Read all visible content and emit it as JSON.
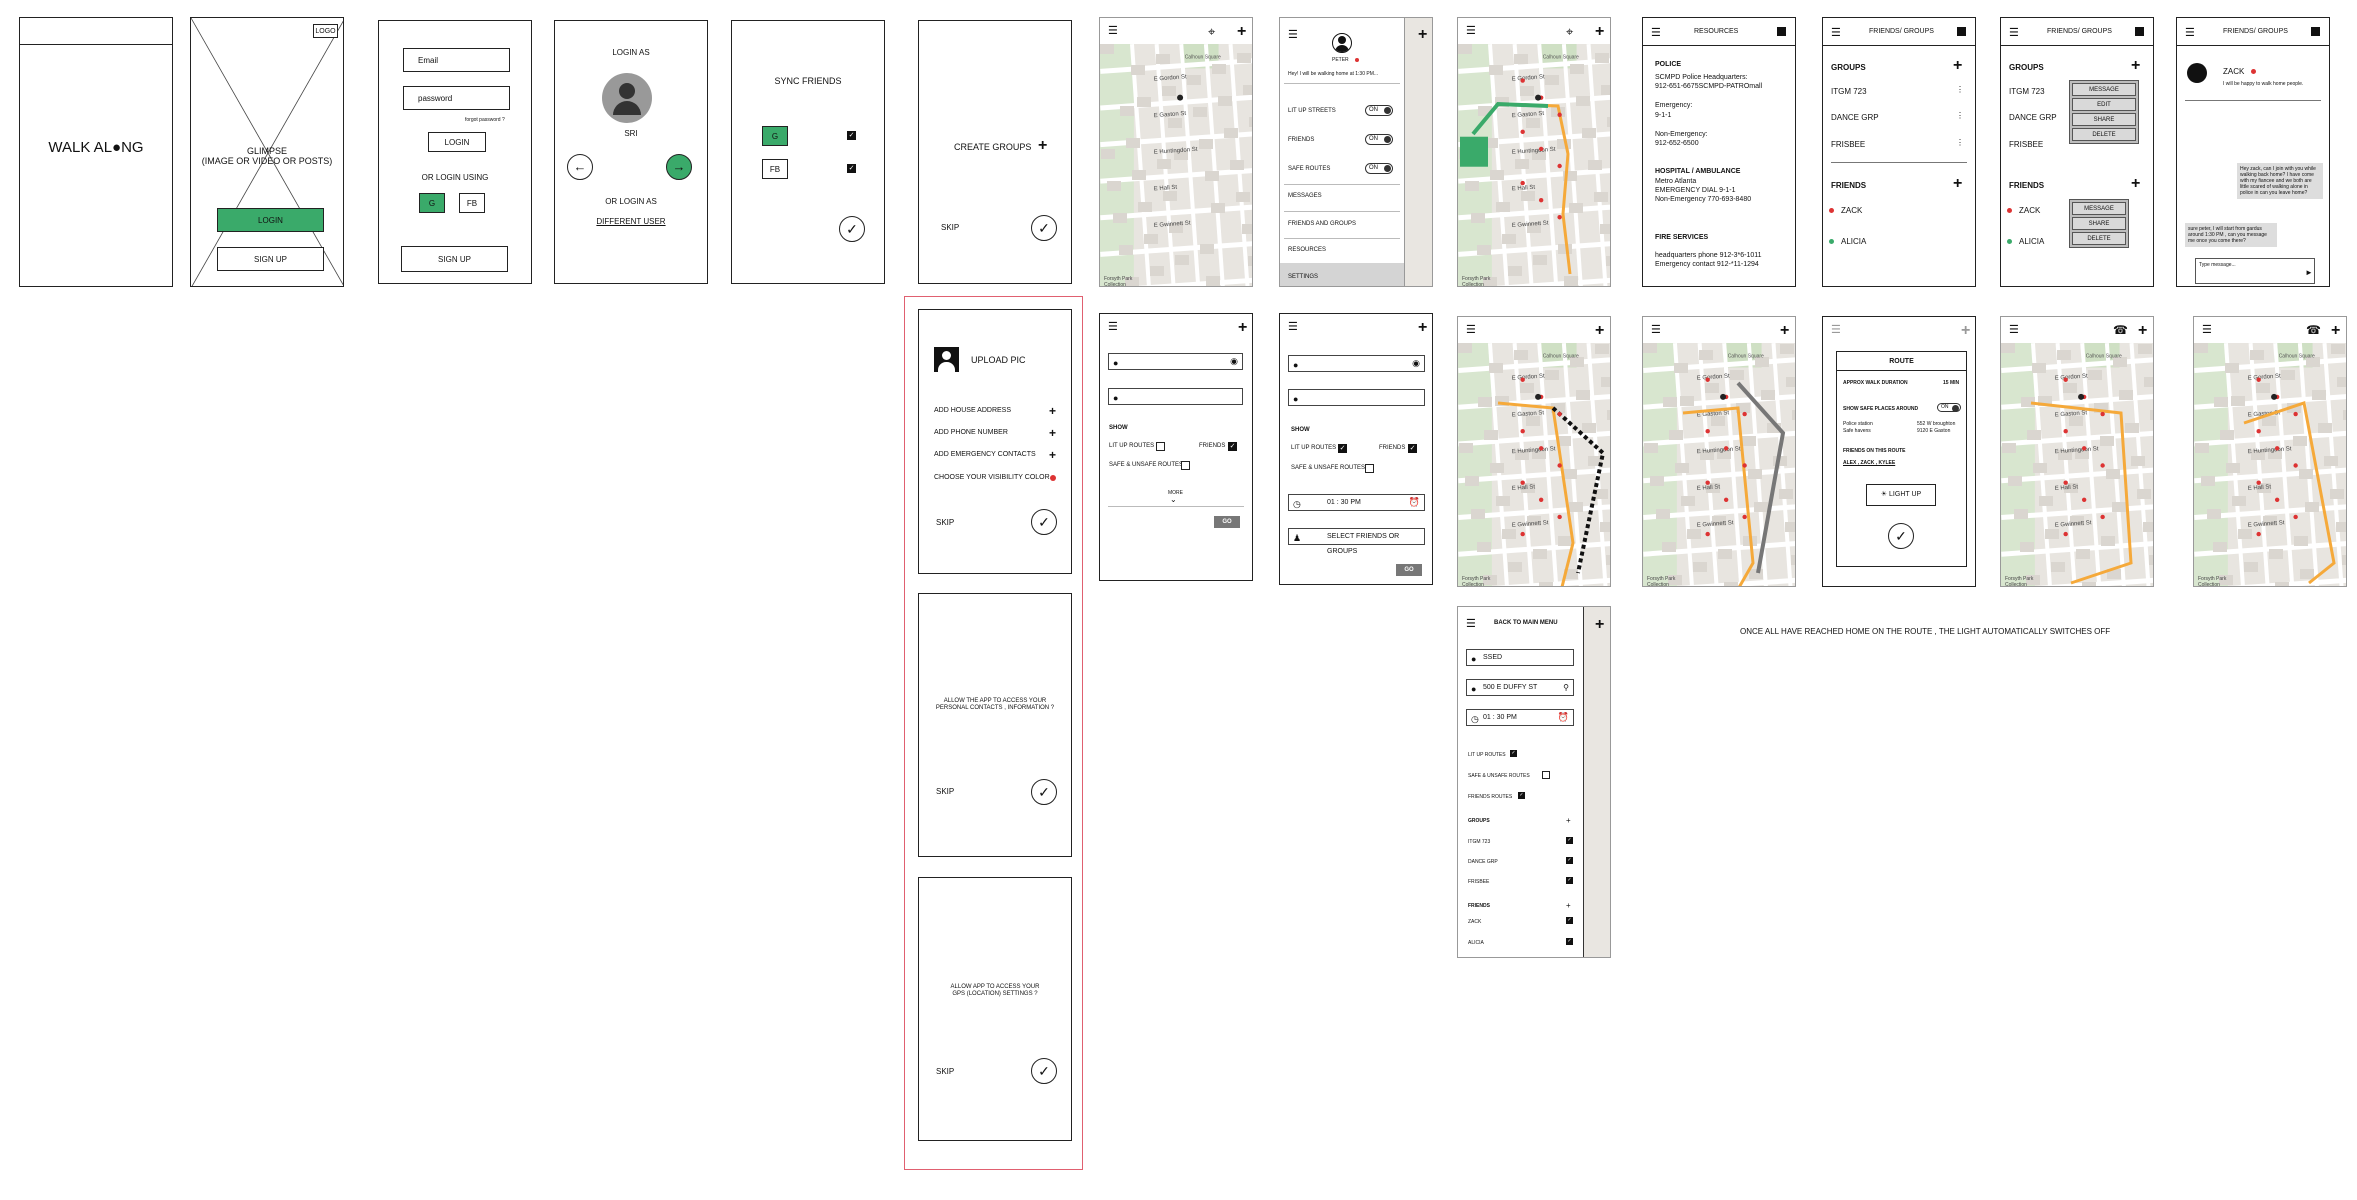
{
  "splash": {
    "title_left": "WALK AL",
    "title_right": "NG",
    "pin_icon": "location-pin-icon"
  },
  "glimpse": {
    "logo": "LOGO",
    "line1": "GLIMPSE",
    "line2": "(IMAGE OR VIDEO OR POSTS)",
    "login": "LOGIN",
    "signup": "SIGN UP"
  },
  "login": {
    "email": "Email",
    "password": "password",
    "forgot": "forgot password ?",
    "login": "LOGIN",
    "or_using": "OR LOGIN USING",
    "g": "G",
    "fb": "FB",
    "signup": "SIGN UP"
  },
  "login_as": {
    "title": "LOGIN AS",
    "name": "SRI",
    "or_login_as": "OR LOGIN AS",
    "different_user": "DIFFERENT USER"
  },
  "sync": {
    "title": "SYNC FRIENDS",
    "g": "G",
    "fb": "FB"
  },
  "create_groups": {
    "title": "CREATE GROUPS",
    "skip": "SKIP"
  },
  "upload": {
    "title": "UPLOAD PIC",
    "items": [
      "ADD HOUSE ADDRESS",
      "ADD PHONE NUMBER",
      "ADD EMERGENCY CONTACTS",
      "CHOOSE YOUR VISIBILITY COLOR"
    ],
    "skip": "SKIP"
  },
  "contacts_perm": {
    "text1": "ALLOW THE APP TO ACCESS YOUR",
    "text2": "PERSONAL CONTACTS , INFORMATION ?",
    "skip": "SKIP"
  },
  "gps_perm": {
    "text1": "ALLOW APP TO ACCESS YOUR",
    "text2": "GPS (LOCATION) SETTINGS ?",
    "skip": "SKIP"
  },
  "side_menu": {
    "user": "PETER",
    "status": "Hey! I will be walking home at 1:30 PM...",
    "items": [
      "LIT UP STREETS",
      "FRIENDS",
      "SAFE ROUTES",
      "MESSAGES",
      "FRIENDS AND GROUPS",
      "RESOURCES",
      "SETTINGS"
    ],
    "on": "ON"
  },
  "resources": {
    "title": "RESOURCES",
    "police_h": "POLICE",
    "police1": "SCMPD Police Headquarters:",
    "police2": "912-651-6675SCMPD-PATROmall",
    "emerg_h": "Emergency:",
    "emerg": "9-1-1",
    "nonemerg_h": "Non-Emergency:",
    "nonemerg": "912-652-6500",
    "hosp_h": "HOSPITAL / AMBULANCE",
    "hosp1": "Metro Atlanta",
    "hosp2": "EMERGENCY DIAL 9-1-1",
    "hosp3": "Non-Emergency 770-693-8480",
    "fire_h": "FIRE SERVICES",
    "fire1": "headquarters phone    912-3*6-1011",
    "fire2": "Emergency contact     912-*11-1294"
  },
  "friends": {
    "title": "FRIENDS/ GROUPS",
    "groups_h": "GROUPS",
    "groups": [
      "ITGM 723",
      "DANCE GRP",
      "FRISBEE"
    ],
    "friends_h": "FRIENDS",
    "friends": [
      "ZACK",
      "ALICIA"
    ],
    "menu1": [
      "MESSAGE",
      "EDIT",
      "SHARE",
      "DELETE"
    ],
    "menu2": [
      "MESSAGE",
      "SHARE",
      "DELETE"
    ]
  },
  "chat": {
    "title": "FRIENDS/ GROUPS",
    "name": "ZACK",
    "status": "I will be happy to walk home people.",
    "msg1": "Hey zack, can I join with you while walking back home? I have come with my fiancee and we both are little scared of walking alone in police in can you leave home?",
    "msg2": "sure peter, I will start from gardus around 1:30 PM , can you message me once you come there?",
    "type": "Type message..."
  },
  "search1": {
    "show": "SHOW",
    "lit": "LIT UP ROUTES",
    "friends": "FRIENDS",
    "safe": "SAFE & UNSAFE ROUTES",
    "more": "MORE",
    "go": "GO"
  },
  "search2": {
    "show": "SHOW",
    "lit": "LIT UP ROUTES",
    "friends": "FRIENDS",
    "safe": "SAFE & UNSAFE ROUTES",
    "time": "01 : 30 PM",
    "select": "SELECT FRIENDS OR GROUPS",
    "go": "GO"
  },
  "route": {
    "title": "ROUTE",
    "approx": "APPROX WALK DURATION",
    "mins": "15 MIN",
    "show_safe": "SHOW SAFE PLACES AROUND",
    "on": "ON",
    "police": "Police station",
    "safe_havens": "Safe havens",
    "addr1": "552 W broughton",
    "addr2": "9120 E Gaston",
    "friends_on": "FRIENDS ON THIS ROUTE",
    "names": "ALEX , ZACK , KYLEE",
    "light": "LIGHT UP"
  },
  "settings": {
    "back": "BACK TO MAIN MENU",
    "loc": "SSED",
    "addr": "500 E DUFFY ST",
    "time": "01 : 30 PM",
    "lit": "LIT UP ROUTES",
    "safe": "SAFE & UNSAFE ROUTES",
    "friends_routes": "FRIENDS ROUTES",
    "groups_h": "GROUPS",
    "groups": [
      "ITGM 723",
      "DANCE GRP",
      "FRISBEE"
    ],
    "friends_h": "FRIENDS",
    "friends": [
      "ZACK",
      "ALICIA"
    ]
  },
  "note": "ONCE ALL HAVE REACHED HOME ON THE ROUTE , THE LIGHT AUTOMATICALLY SWITCHES OFF",
  "map": {
    "streets": [
      "E Gordon St",
      "E Gaston St",
      "E Huntingdon St",
      "E Hall St",
      "E Gwinnett St"
    ],
    "park": "Calhoun Square",
    "footer": "Forsyth Park",
    "footer2": "Collection"
  },
  "colors": {
    "green": "#3aaa6a",
    "orange": "#f5a93a",
    "red_outline": "#e06070",
    "route_gray": "#777777"
  }
}
